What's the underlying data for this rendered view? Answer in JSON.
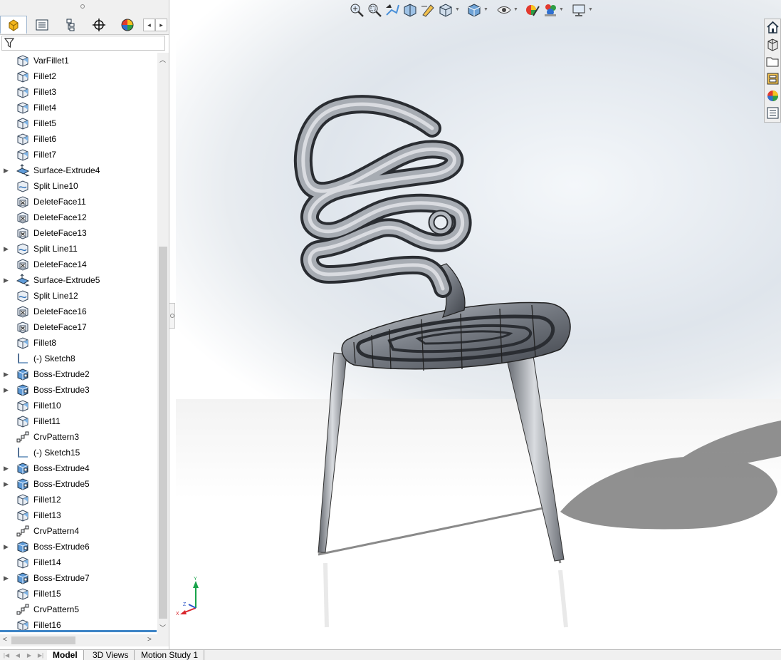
{
  "feature_tree": {
    "filter_icon": "filter-icon",
    "tabs": [
      {
        "name": "feature-manager-tab",
        "icon": "feature-manager-icon"
      },
      {
        "name": "property-manager-tab",
        "icon": "property-manager-icon"
      },
      {
        "name": "configuration-manager-tab",
        "icon": "configuration-manager-icon"
      },
      {
        "name": "dimxpert-manager-tab",
        "icon": "dimxpert-icon"
      },
      {
        "name": "display-manager-tab",
        "icon": "display-manager-icon"
      }
    ],
    "items": [
      {
        "label": "VarFillet1",
        "icon": "fillet",
        "expandable": false
      },
      {
        "label": "Fillet2",
        "icon": "fillet",
        "expandable": false
      },
      {
        "label": "Fillet3",
        "icon": "fillet",
        "expandable": false
      },
      {
        "label": "Fillet4",
        "icon": "fillet",
        "expandable": false
      },
      {
        "label": "Fillet5",
        "icon": "fillet",
        "expandable": false
      },
      {
        "label": "Fillet6",
        "icon": "fillet",
        "expandable": false
      },
      {
        "label": "Fillet7",
        "icon": "fillet",
        "expandable": false
      },
      {
        "label": "Surface-Extrude4",
        "icon": "surface",
        "expandable": true
      },
      {
        "label": "Split Line10",
        "icon": "splitline",
        "expandable": false
      },
      {
        "label": "DeleteFace11",
        "icon": "deleteface",
        "expandable": false
      },
      {
        "label": "DeleteFace12",
        "icon": "deleteface",
        "expandable": false
      },
      {
        "label": "DeleteFace13",
        "icon": "deleteface",
        "expandable": false
      },
      {
        "label": "Split Line11",
        "icon": "splitline",
        "expandable": true
      },
      {
        "label": "DeleteFace14",
        "icon": "deleteface",
        "expandable": false
      },
      {
        "label": "Surface-Extrude5",
        "icon": "surface",
        "expandable": true
      },
      {
        "label": "Split Line12",
        "icon": "splitline",
        "expandable": false
      },
      {
        "label": "DeleteFace16",
        "icon": "deleteface",
        "expandable": false
      },
      {
        "label": "DeleteFace17",
        "icon": "deleteface",
        "expandable": false
      },
      {
        "label": "Fillet8",
        "icon": "fillet",
        "expandable": false
      },
      {
        "label": "(-) Sketch8",
        "icon": "sketch",
        "expandable": false
      },
      {
        "label": "Boss-Extrude2",
        "icon": "boss",
        "expandable": true
      },
      {
        "label": "Boss-Extrude3",
        "icon": "boss",
        "expandable": true
      },
      {
        "label": "Fillet10",
        "icon": "fillet",
        "expandable": false
      },
      {
        "label": "Fillet11",
        "icon": "fillet",
        "expandable": false
      },
      {
        "label": "CrvPattern3",
        "icon": "pattern",
        "expandable": false
      },
      {
        "label": "(-) Sketch15",
        "icon": "sketch",
        "expandable": false
      },
      {
        "label": "Boss-Extrude4",
        "icon": "boss",
        "expandable": true
      },
      {
        "label": "Boss-Extrude5",
        "icon": "boss",
        "expandable": true
      },
      {
        "label": "Fillet12",
        "icon": "fillet",
        "expandable": false
      },
      {
        "label": "Fillet13",
        "icon": "fillet",
        "expandable": false
      },
      {
        "label": "CrvPattern4",
        "icon": "pattern",
        "expandable": false
      },
      {
        "label": "Boss-Extrude6",
        "icon": "boss",
        "expandable": true
      },
      {
        "label": "Fillet14",
        "icon": "fillet",
        "expandable": false
      },
      {
        "label": "Boss-Extrude7",
        "icon": "boss",
        "expandable": true
      },
      {
        "label": "Fillet15",
        "icon": "fillet",
        "expandable": false
      },
      {
        "label": "CrvPattern5",
        "icon": "pattern",
        "expandable": false
      },
      {
        "label": "Fillet16",
        "icon": "fillet",
        "expandable": false
      }
    ]
  },
  "bottom_tabs": [
    "Model",
    "3D Views",
    "Motion Study 1"
  ],
  "active_bottom_tab": "Model",
  "headsup_toolbar": [
    "zoom-to-fit-icon",
    "zoom-to-area-icon",
    "previous-view-icon",
    "section-view-icon",
    "dynamic-annotation-icon",
    "view-orientation-icon",
    "display-style-icon",
    "hide-show-items-icon",
    "edit-appearance-icon",
    "apply-scene-icon",
    "view-settings-icon"
  ],
  "task_pane": [
    "home-icon",
    "design-library-icon",
    "file-explorer-icon",
    "view-palette-icon",
    "appearances-icon",
    "custom-properties-icon"
  ],
  "triad_axes": {
    "x": "X",
    "y": "Y",
    "z": "Z"
  },
  "colors": {
    "selection_bar": "#3d84c6",
    "model_metal": "#8a8f96",
    "triad_y": "#18a34a",
    "triad_x": "#d9252b",
    "triad_z": "#2b55c7"
  }
}
